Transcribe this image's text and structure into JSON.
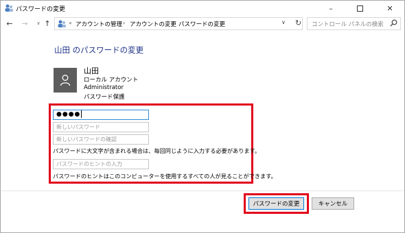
{
  "window": {
    "title": "パスワードの変更"
  },
  "nav": {
    "breadcrumbs": [
      "アカウントの管理",
      "アカウントの変更",
      "パスワードの変更"
    ],
    "search_placeholder": "コントロール パネルの検索"
  },
  "page": {
    "title": "山田 のパスワードの変更"
  },
  "user": {
    "name": "山田",
    "account_type": "ローカル アカウント",
    "role": "Administrator",
    "protection": "パスワード保護"
  },
  "form": {
    "current_password_value": "●●●●",
    "new_password_placeholder": "新しいパスワード",
    "confirm_password_placeholder": "新しいパスワードの確認",
    "case_note": "パスワードに大文字が含まれる場合は、毎回同じように入力する必要があります。",
    "hint_placeholder": "パスワードのヒントの入力",
    "hint_note": "パスワードのヒントはこのコンピューターを使用するすべての人が見ることができます。"
  },
  "buttons": {
    "change_label": "パスワードの変更",
    "cancel_label": "キャンセル"
  },
  "colors": {
    "highlight": "#e0001b",
    "title_blue": "#1e3287",
    "focus_border": "#2d8dd6"
  }
}
